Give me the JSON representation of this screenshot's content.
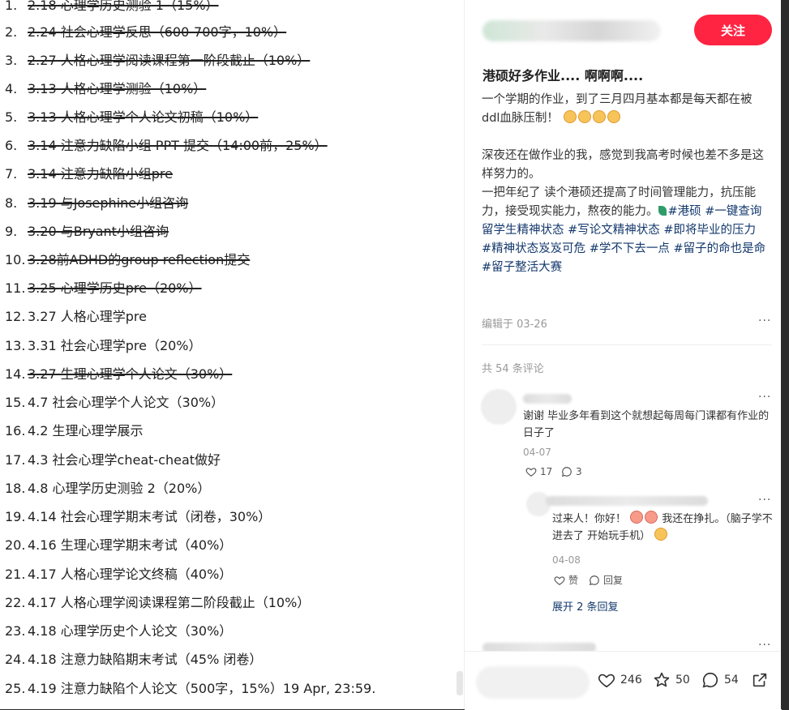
{
  "todos": [
    {
      "num": "1.",
      "text": "2.18 心理学历史测验 1（15%）",
      "done": true
    },
    {
      "num": "2.",
      "text": "2.24 社会心理学反思（600-700字，10%）",
      "done": true
    },
    {
      "num": "3.",
      "text": "2.27 人格心理学阅读课程第一阶段截止（10%）",
      "done": true
    },
    {
      "num": "4.",
      "text": "3.13 人格心理学测验（10%）",
      "done": true
    },
    {
      "num": "5.",
      "text": "3.13 人格心理学个人论文初稿（10%）",
      "done": true
    },
    {
      "num": "6.",
      "text": "3.14 注意力缺陷小组 PPT 提交（14:00前，25%）",
      "done": true
    },
    {
      "num": "7.",
      "text": "3.14 注意力缺陷小组pre",
      "done": true
    },
    {
      "num": "8.",
      "text": "3.19 与Josephine小组咨询",
      "done": true
    },
    {
      "num": "9.",
      "text": "3.20 与Bryant小组咨询",
      "done": true
    },
    {
      "num": "10.",
      "text": "3.28前ADHD的group reflection提交",
      "done": true
    },
    {
      "num": "11.",
      "text": "3.25 心理学历史pre（20%）",
      "done": true
    },
    {
      "num": "12.",
      "text": "3.27 人格心理学pre",
      "done": false
    },
    {
      "num": "13.",
      "text": "3.31 社会心理学pre（20%）",
      "done": false
    },
    {
      "num": "14.",
      "text": "3.27 生理心理学个人论文（30%）",
      "done": true
    },
    {
      "num": "15.",
      "text": "4.7 社会心理学个人论文（30%）",
      "done": false
    },
    {
      "num": "16.",
      "text": "4.2 生理心理学展示",
      "done": false
    },
    {
      "num": "17.",
      "text": "4.3 社会心理学cheat-cheat做好",
      "done": false
    },
    {
      "num": "18.",
      "text": "4.8 心理学历史测验 2（20%）",
      "done": false
    },
    {
      "num": "19.",
      "text": "4.14 社会心理学期末考试（闭卷，30%）",
      "done": false
    },
    {
      "num": "20.",
      "text": "4.16 生理心理学期末考试（40%）",
      "done": false
    },
    {
      "num": "21.",
      "text": "4.17 人格心理学论文终稿（40%）",
      "done": false
    },
    {
      "num": "22.",
      "text": "4.17 人格心理学阅读课程第二阶段截止（10%）",
      "done": false
    },
    {
      "num": "23.",
      "text": "4.18 心理学历史个人论文（30%）",
      "done": false
    },
    {
      "num": "24.",
      "text": "4.18 注意力缺陷期末考试（45% 闭卷）",
      "done": false
    },
    {
      "num": "25.",
      "text": "4.19 注意力缺陷个人论文（500字，15%）19 Apr, 23:59.",
      "done": false
    }
  ],
  "post": {
    "follow_label": "关注",
    "title": "港硕好多作业.... 啊啊啊....",
    "body_1": "一个学期的作业，到了三月四月基本都是每天都在被ddl血脉压制！",
    "body_2": "深夜还在做作业的我，感觉到我高考时候也差不多是这样努力的。",
    "body_3": "一把年纪了 读个港硕还提高了时间管理能力，抗压能力，接受现实能力，熬夜的能力。",
    "tags": [
      "#港硕",
      "#一键查询留学生精神状态",
      "#写论文精神状态",
      "#即将毕业的压力",
      "#精神状态岌岌可危",
      "#学不下去一点",
      "#留子的命也是命",
      "#留子整活大赛"
    ],
    "edited": "编辑于 03-26",
    "more": "···"
  },
  "comments": {
    "count_label": "共 54 条评论",
    "first": {
      "text": "谢谢 毕业多年看到这个就想起每周每门课都有作业的日子了",
      "date": "04-07",
      "likes": "17",
      "replies": "3"
    },
    "reply": {
      "text_a": "过来人！你好！",
      "text_b": "我还在挣扎。（脑子学不进去了 开始玩手机）",
      "date": "04-08",
      "like_label": "赞",
      "reply_label": "回复"
    },
    "expand_label": "展开 2 条回复"
  },
  "footer": {
    "likes": "246",
    "stars": "50",
    "comments": "54"
  },
  "colors": {
    "accent": "#ff2442",
    "tag": "#13386c"
  }
}
